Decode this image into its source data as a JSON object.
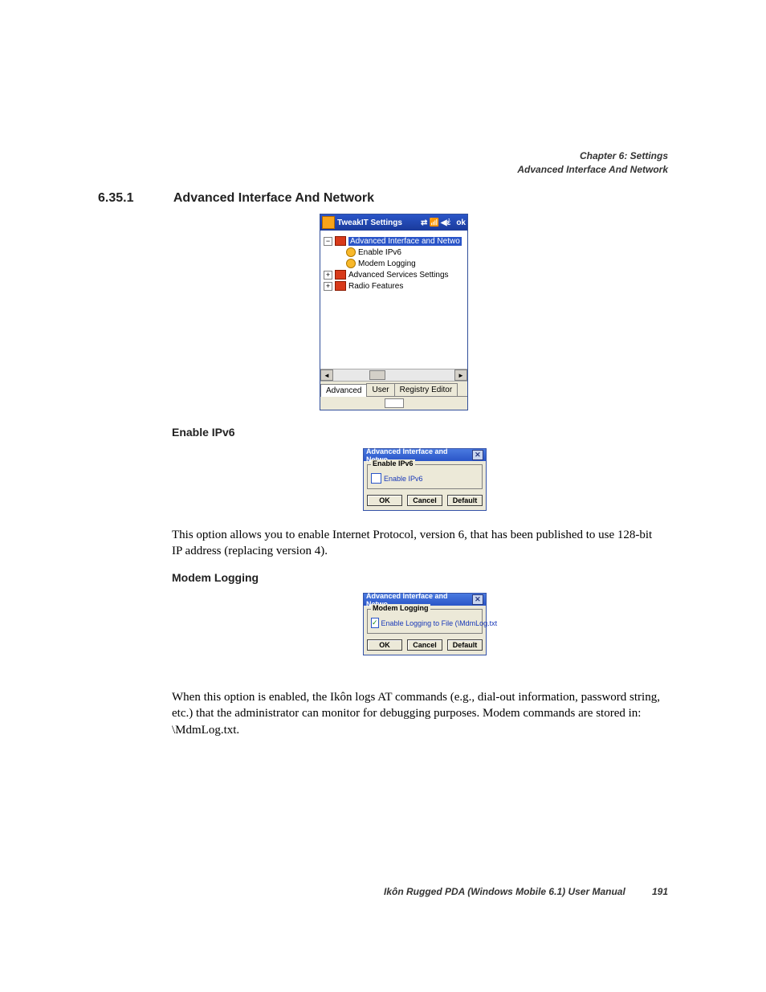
{
  "header": {
    "chapter": "Chapter 6: Settings",
    "section": "Advanced Interface And Network"
  },
  "heading": {
    "number": "6.35.1",
    "title": "Advanced Interface And Network"
  },
  "win1": {
    "title": "TweakIT Settings",
    "ok": "ok",
    "tree": {
      "root": "Advanced Interface and Netwo",
      "items": [
        "Enable IPv6",
        "Modem Logging"
      ],
      "siblings": [
        "Advanced Services Settings",
        "Radio Features"
      ]
    },
    "tabs": [
      "Advanced",
      "User",
      "Registry Editor"
    ]
  },
  "sub1": {
    "title": "Enable IPv6"
  },
  "dlg1": {
    "title": "Advanced Interface and Netwo…",
    "legend": "Enable IPv6",
    "checkbox": "Enable IPv6",
    "buttons": [
      "OK",
      "Cancel",
      "Default"
    ]
  },
  "para1": "This option allows you to enable Internet Protocol, version 6, that has been published to use 128-bit IP address (replacing version 4).",
  "sub2": {
    "title": "Modem Logging"
  },
  "dlg2": {
    "title": "Advanced Interface and Netwo…",
    "legend": "Modem Logging",
    "checkbox": "Enable Logging to File (\\MdmLog.txt",
    "buttons": [
      "OK",
      "Cancel",
      "Default"
    ]
  },
  "para2": "When this option is enabled, the Ikôn logs AT commands (e.g., dial-out information, password string, etc.) that the administrator can monitor for debugging purposes. Modem commands are stored in: \\MdmLog.txt.",
  "footer": {
    "title": "Ikôn Rugged PDA (Windows Mobile 6.1) User Manual",
    "page": "191"
  }
}
